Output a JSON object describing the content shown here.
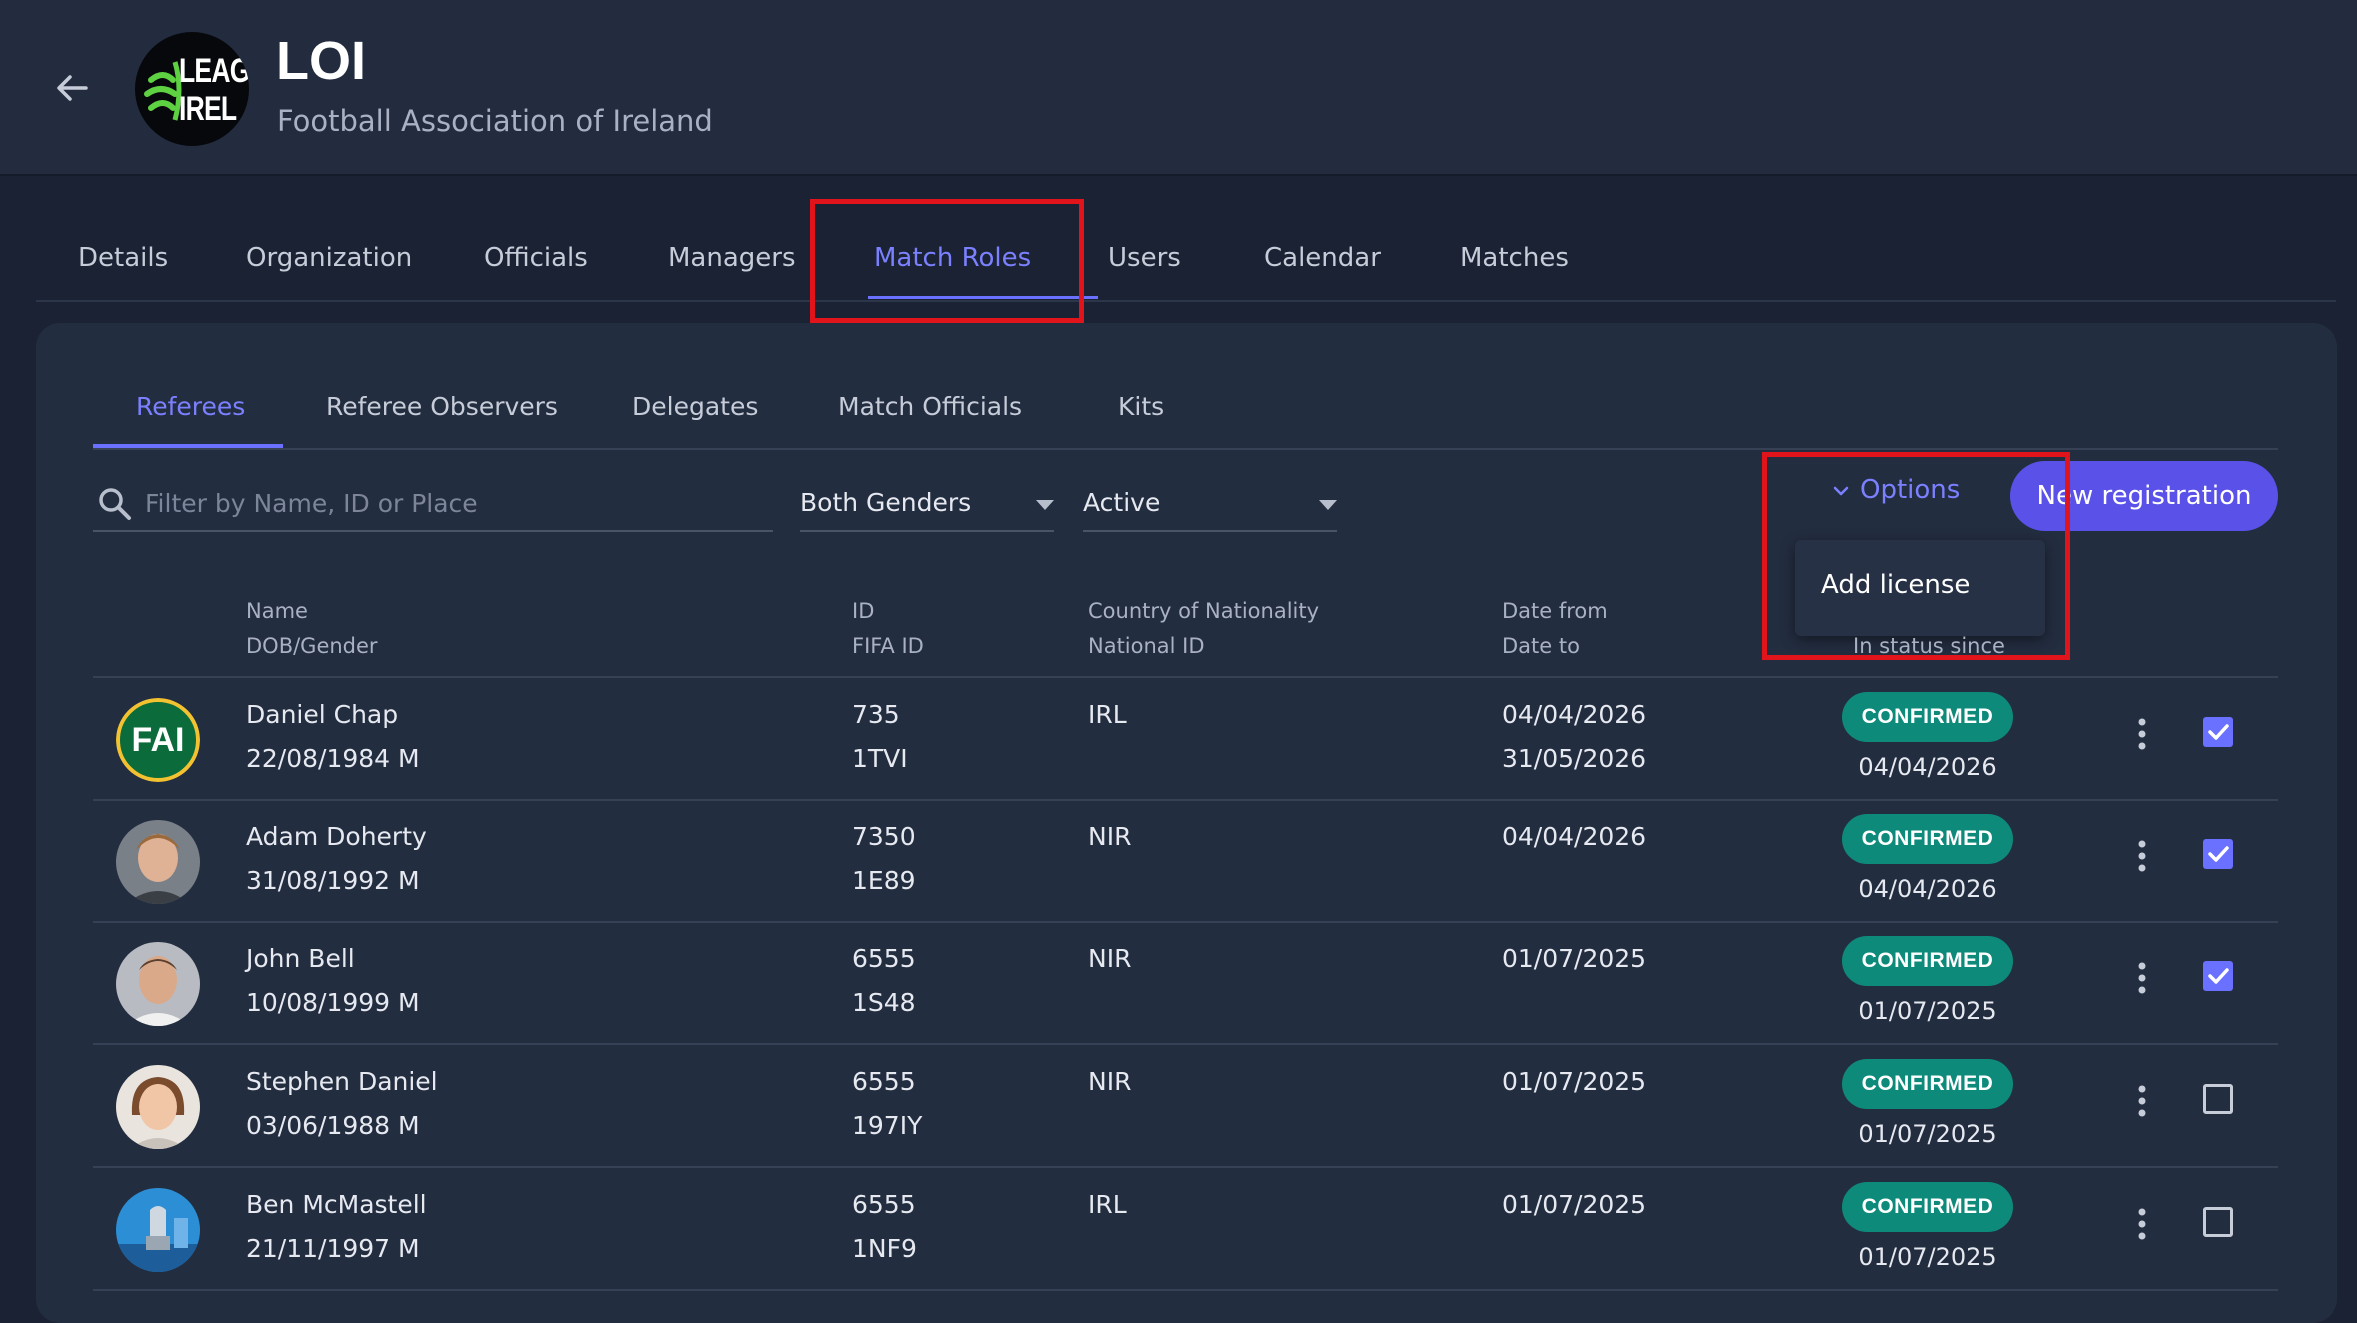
{
  "header": {
    "logo_text_line1": "LEAGU",
    "logo_text_line2": "IREL",
    "org_code": "LOI",
    "org_name": "Football Association of Ireland"
  },
  "tabs": [
    {
      "label": "Details"
    },
    {
      "label": "Organization"
    },
    {
      "label": "Officials"
    },
    {
      "label": "Managers"
    },
    {
      "label": "Match Roles",
      "active": true
    },
    {
      "label": "Users"
    },
    {
      "label": "Calendar"
    },
    {
      "label": "Matches"
    }
  ],
  "subtabs": [
    {
      "label": "Referees",
      "active": true
    },
    {
      "label": "Referee Observers"
    },
    {
      "label": "Delegates"
    },
    {
      "label": "Match Officials"
    },
    {
      "label": "Kits"
    }
  ],
  "filters": {
    "search_placeholder": "Filter by Name, ID or Place",
    "gender_value": "Both Genders",
    "status_value": "Active"
  },
  "actions": {
    "options_label": "Options",
    "new_registration_label": "New registration",
    "menu_items": [
      "Add license"
    ]
  },
  "table": {
    "headers": {
      "name": "Name",
      "dob_gender": "DOB/Gender",
      "id": "ID",
      "fifa_id": "FIFA ID",
      "country": "Country of Nationality",
      "national_id": "National ID",
      "date_from": "Date from",
      "date_to": "Date to",
      "status_since": "In status since"
    },
    "rows": [
      {
        "name": "Daniel Chap",
        "dob_gender": "22/08/1984 M",
        "id": "735",
        "fifa_id": "1TVI",
        "country": "IRL",
        "date_from": "04/04/2026",
        "date_to": "31/05/2026",
        "status": "CONFIRMED",
        "status_since": "04/04/2026",
        "checked": true,
        "avatar": "fai-logo"
      },
      {
        "name": "Adam Doherty",
        "dob_gender": "31/08/1992 M",
        "id": "7350",
        "fifa_id": "1E89",
        "country": "NIR",
        "date_from": "04/04/2026",
        "date_to": "",
        "status": "CONFIRMED",
        "status_since": "04/04/2026",
        "checked": true,
        "avatar": "photo"
      },
      {
        "name": "John Bell",
        "dob_gender": "10/08/1999 M",
        "id": "6555",
        "fifa_id": "1S48",
        "country": "NIR",
        "date_from": "01/07/2025",
        "date_to": "",
        "status": "CONFIRMED",
        "status_since": "01/07/2025",
        "checked": true,
        "avatar": "photo"
      },
      {
        "name": "Stephen Daniel",
        "dob_gender": "03/06/1988 M",
        "id": "6555",
        "fifa_id": "197IY",
        "country": "NIR",
        "date_from": "01/07/2025",
        "date_to": "",
        "status": "CONFIRMED",
        "status_since": "01/07/2025",
        "checked": false,
        "avatar": "photo"
      },
      {
        "name": "Ben McMastell",
        "dob_gender": "21/11/1997 M",
        "id": "6555",
        "fifa_id": "1NF9",
        "country": "IRL",
        "date_from": "01/07/2025",
        "date_to": "",
        "status": "CONFIRMED",
        "status_since": "01/07/2025",
        "checked": false,
        "avatar": "photo"
      }
    ]
  },
  "colors": {
    "accent": "#6a70ff",
    "status_confirmed": "#0e8a7b",
    "highlight": "#e0141a"
  }
}
